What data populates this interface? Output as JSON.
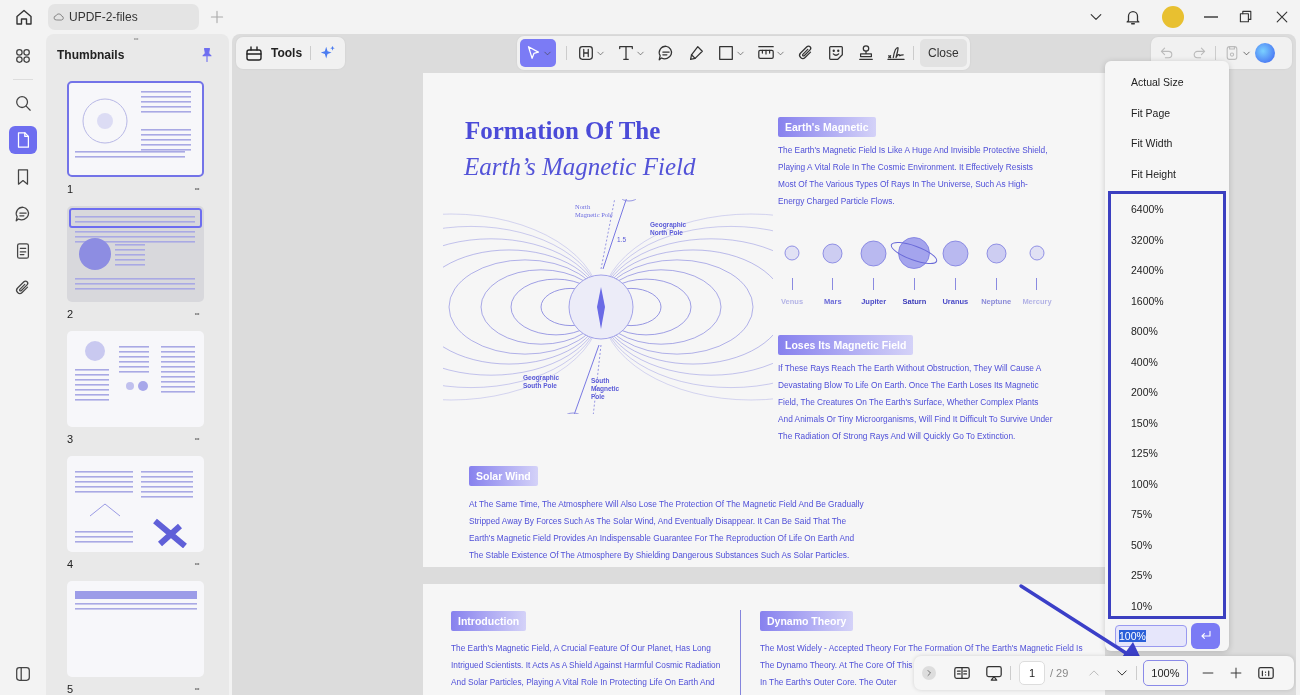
{
  "tabs": [
    {
      "label": "UPDF-2-files",
      "selected": true
    }
  ],
  "rail": [
    {
      "kind": "apps",
      "selected": false
    },
    {
      "kind": "search",
      "selected": false
    },
    {
      "kind": "pages",
      "selected": true
    },
    {
      "kind": "bookmark",
      "selected": false
    },
    {
      "kind": "comment",
      "selected": false
    },
    {
      "kind": "form",
      "selected": false
    },
    {
      "kind": "attachment",
      "selected": false
    }
  ],
  "thumbnails_panel": {
    "title": "Thumbnails",
    "pinned": true,
    "pages": [
      {
        "number": "1",
        "selected": true
      },
      {
        "number": "2",
        "selected": false
      },
      {
        "number": "3",
        "selected": false
      },
      {
        "number": "4",
        "selected": false
      },
      {
        "number": "5",
        "selected": false
      }
    ]
  },
  "tools_button": {
    "label": "Tools"
  },
  "toolbar": [
    {
      "kind": "select",
      "selected": true,
      "dropdown": true
    },
    {
      "kind": "textbox",
      "selected": false,
      "dropdown": true
    },
    {
      "kind": "text",
      "selected": false,
      "dropdown": true
    },
    {
      "kind": "comment",
      "selected": false,
      "dropdown": false
    },
    {
      "kind": "highlighter",
      "selected": false,
      "dropdown": false
    },
    {
      "kind": "shape",
      "selected": false,
      "dropdown": true
    },
    {
      "kind": "measure",
      "selected": false,
      "dropdown": true
    },
    {
      "kind": "attach",
      "selected": false,
      "dropdown": false
    },
    {
      "kind": "sticker",
      "selected": false,
      "dropdown": false
    },
    {
      "kind": "stamp",
      "selected": false,
      "dropdown": false
    },
    {
      "kind": "signature",
      "selected": false,
      "dropdown": false
    }
  ],
  "close_button": {
    "label": "Close"
  },
  "history": {
    "undo_disabled": true,
    "redo_disabled": true,
    "save_disabled": true
  },
  "page1": {
    "title_line1": "Formation Of The",
    "title_line2": "Earth’s Magnetic Field",
    "diagram_labels": {
      "north_magnetic": [
        "North",
        "Magnetic Pole"
      ],
      "geographic_north": [
        "Geographic",
        "North Pole"
      ],
      "angle": "1.5",
      "geographic_south": [
        "Geographic",
        "South Pole"
      ],
      "south_magnetic": [
        "South",
        "Magnetic",
        "Pole"
      ]
    },
    "sections": [
      {
        "heading": "Earth's Magnetic",
        "text": "The Earth's Magnetic Field Is Like A Huge And Invisible Protective Shield, Playing A Vital Role In The Cosmic Environment. It Effectively Resists Most Of The Various Types Of Rays In The Universe, Such As High-Energy Charged Particle Flows."
      },
      {
        "heading": "Loses Its Magnetic Field",
        "text": "If These Rays Reach The Earth Without Obstruction, They Will Cause A Devastating Blow To Life On Earth. Once The Earth Loses Its Magnetic Field, The Creatures On The Earth's Surface, Whether Complex Plants And Animals Or Tiny Microorganisms, Will Find It Difficult To Survive Under The Radiation Of Strong Rays And Will Quickly Go To Extinction."
      }
    ],
    "planets": [
      {
        "name": "Venus"
      },
      {
        "name": "Mars"
      },
      {
        "name": "Jupiter"
      },
      {
        "name": "Saturn"
      },
      {
        "name": "Uranus"
      },
      {
        "name": "Neptune"
      },
      {
        "name": "Mercury"
      }
    ],
    "solar_wind": {
      "heading": "Solar Wind",
      "text": "At The Same Time, The Atmosphere Will Also Lose The Protection Of The Magnetic Field And Be Gradually Stripped Away By Forces Such As The Solar Wind, And Eventually Disappear. It Can Be Said That The Earth's Magnetic Field Provides An Indispensable Guarantee For The Reproduction Of Life On Earth And The Stable Existence Of The Atmosphere By Shielding Dangerous Substances Such As Solar Particles."
    }
  },
  "page2": {
    "introduction": {
      "heading": "Introduction",
      "lines": [
        "The Earth's Magnetic Field, A Crucial Feature Of Our Planet, Has Long",
        "Intrigued Scientists. It Acts As A Shield Against Harmful Cosmic Radiation",
        "And Solar Particles, Playing A Vital Role In Protecting Life On Earth And"
      ]
    },
    "dynamo": {
      "heading": "Dynamo Theory",
      "lines": [
        "The Most Widely - Accepted Theory For The Formation Of The Earth's Magnetic Field Is",
        "The Dynamo Theory. At The Core Of This",
        "In The Earth's Outer Core. The Outer"
      ]
    }
  },
  "zoom_menu": {
    "fit_options": [
      "Actual Size",
      "Fit Page",
      "Fit Width",
      "Fit Height"
    ],
    "levels": [
      "6400%",
      "3200%",
      "2400%",
      "1600%",
      "800%",
      "400%",
      "200%",
      "150%",
      "125%",
      "100%",
      "75%",
      "50%",
      "25%",
      "10%"
    ],
    "input": "100%"
  },
  "bottom_bar": {
    "page": "1",
    "total": "/ 29",
    "previous_disabled": true,
    "zoom": "100%"
  }
}
